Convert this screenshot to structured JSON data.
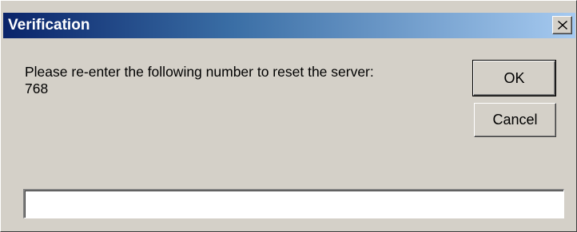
{
  "window": {
    "title": "Verification",
    "close_icon": "close-icon"
  },
  "message": {
    "prompt": "Please re-enter the following number to reset the server:",
    "number": "768"
  },
  "buttons": {
    "ok_label": "OK",
    "cancel_label": "Cancel"
  },
  "input": {
    "value": "",
    "placeholder": ""
  },
  "colors": {
    "dialog_face": "#d4d0c8",
    "titlebar_start": "#0a246a",
    "titlebar_end": "#a6caf0",
    "title_text": "#ffffff"
  }
}
